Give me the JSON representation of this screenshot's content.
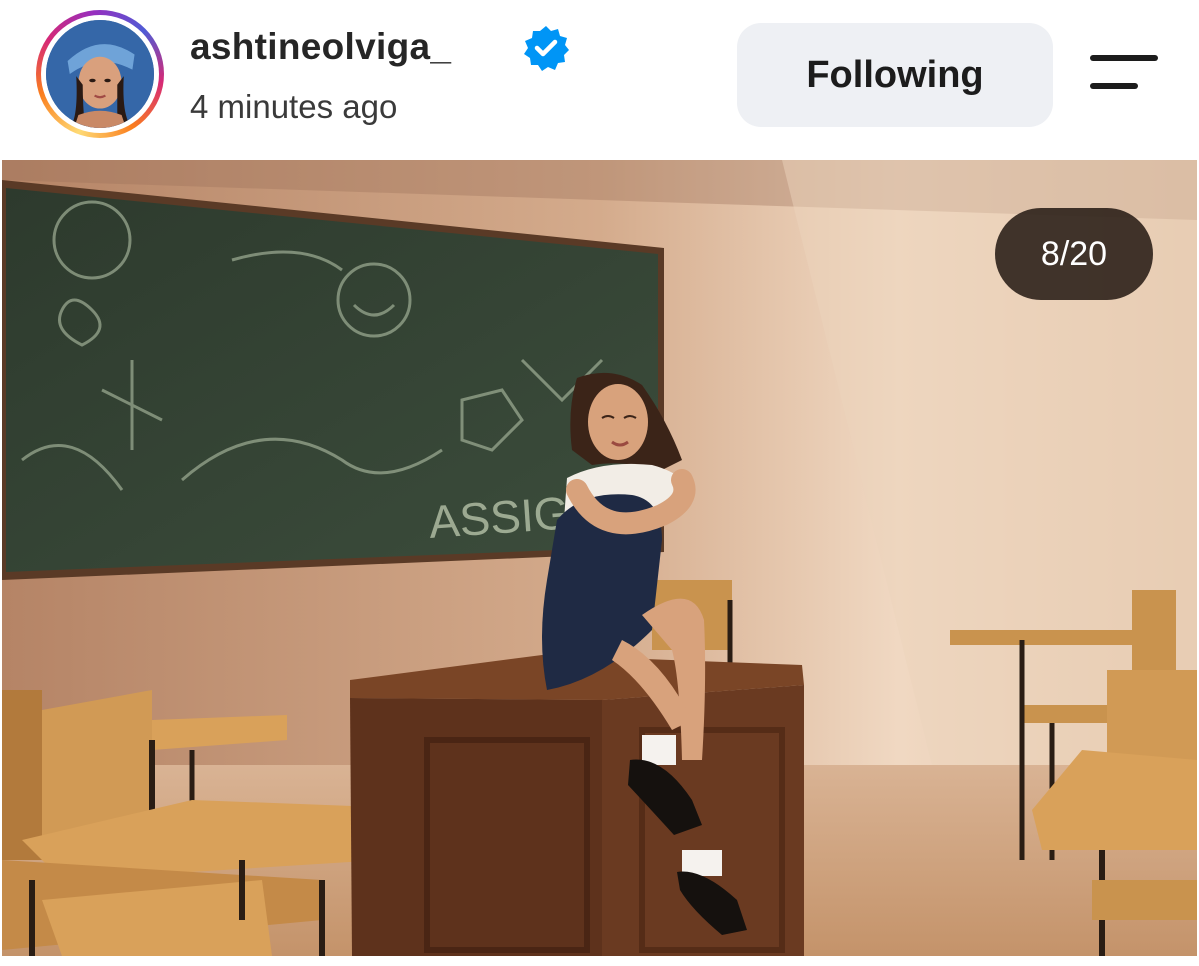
{
  "post": {
    "username": "ashtineolviga_",
    "timestamp": "4 minutes ago",
    "follow_label": "Following",
    "verified": true,
    "carousel_counter": "8/20"
  },
  "icons": {
    "verified": "verified-badge-icon",
    "menu": "menu-icon"
  },
  "colors": {
    "verified_blue": "#0095f6",
    "follow_button_bg": "#eef0f4",
    "text": "#262626"
  }
}
